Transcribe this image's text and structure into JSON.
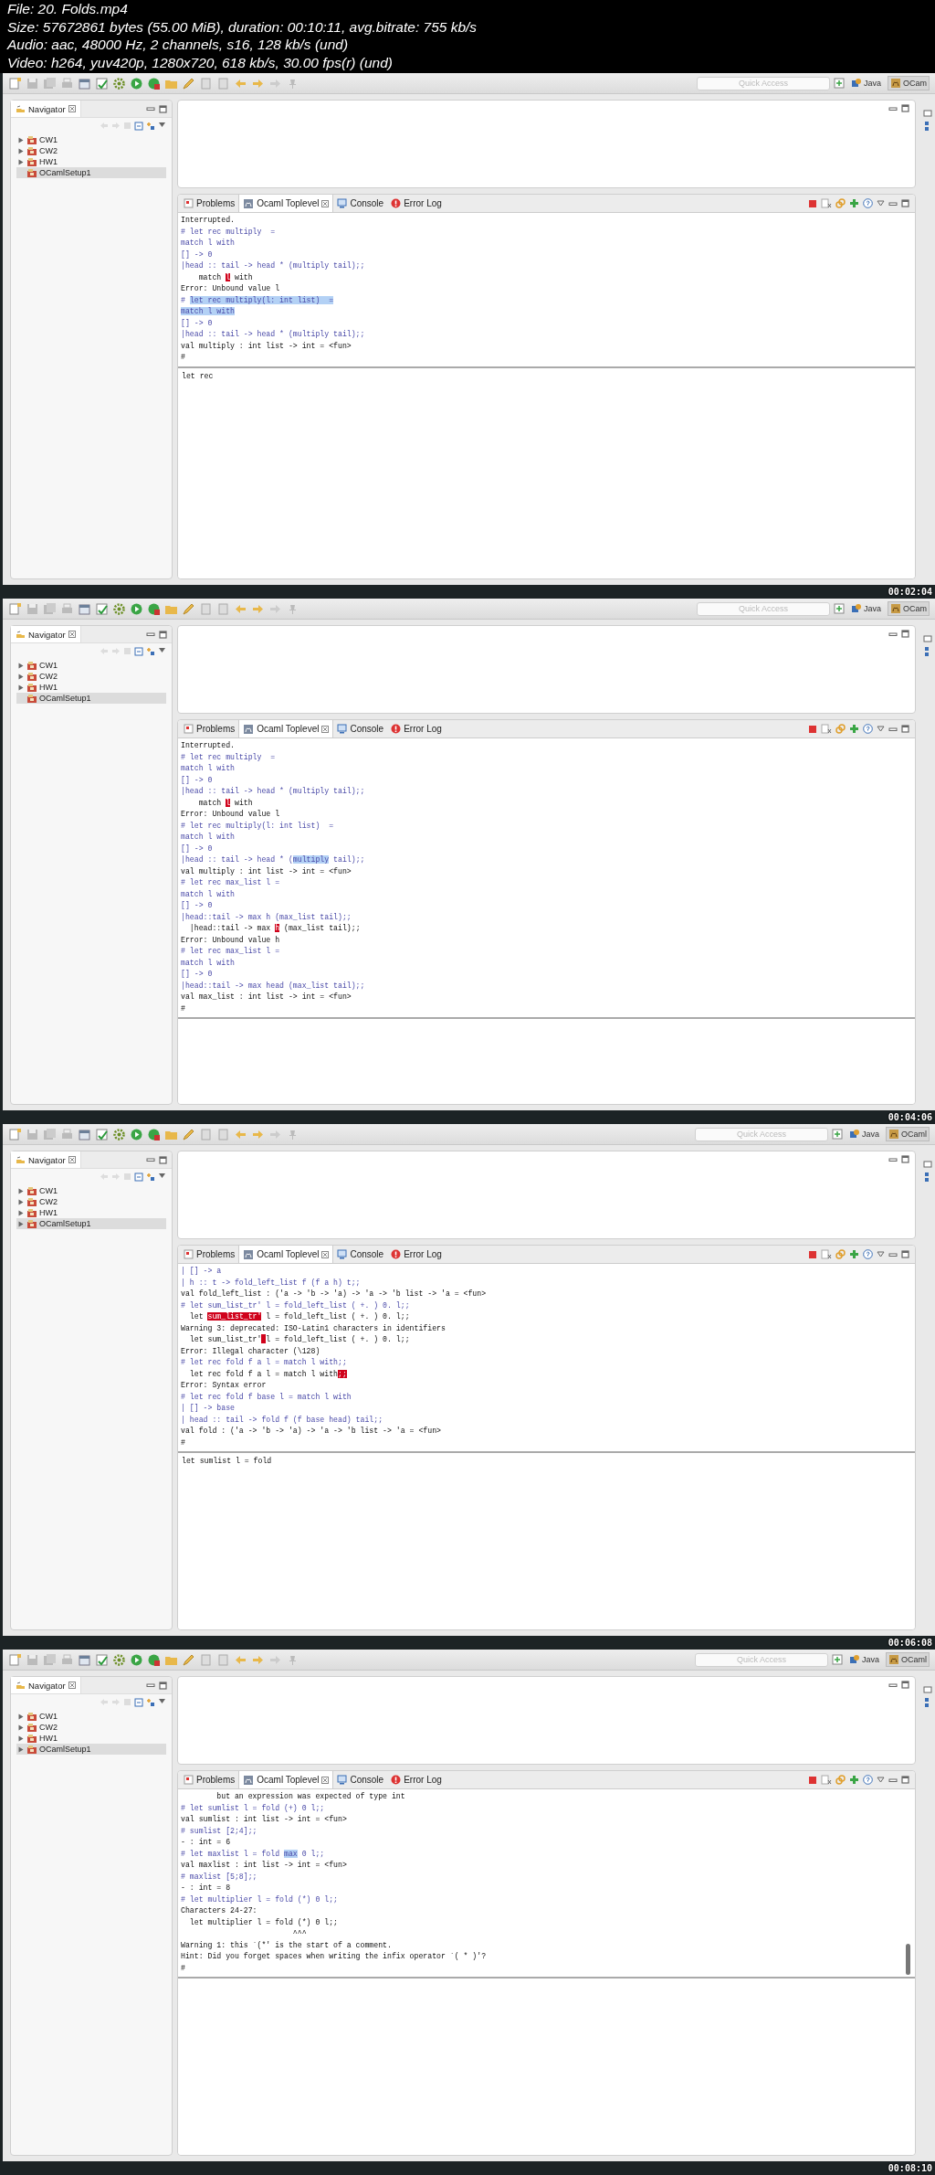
{
  "video_info": [
    "File: 20. Folds.mp4",
    "Size: 57672861 bytes (55.00 MiB), duration: 00:10:11, avg.bitrate: 755 kb/s",
    "Audio: aac, 48000 Hz, 2 channels, s16, 128 kb/s (und)",
    "Video: h264, yuv420p, 1280x720, 618 kb/s, 30.00 fps(r) (und)"
  ],
  "frames": [
    {
      "timestamp": "00:02:04",
      "quick_access": {
        "placeholder": "Quick Access"
      },
      "perspectives": [
        {
          "label": "Java",
          "selected": false
        },
        {
          "label": "OCam",
          "selected": true
        }
      ],
      "navigator": {
        "title": "Navigator",
        "items": [
          {
            "label": "CW1",
            "expandable": true,
            "selected": false
          },
          {
            "label": "CW2",
            "expandable": true,
            "selected": false
          },
          {
            "label": "HW1",
            "expandable": true,
            "selected": false
          },
          {
            "label": "OCamlSetup1",
            "expandable": false,
            "selected": true
          }
        ]
      },
      "console_tabs": [
        {
          "label": "Problems",
          "selected": false
        },
        {
          "label": "Ocaml Toplevel",
          "selected": true
        },
        {
          "label": "Console",
          "selected": false
        },
        {
          "label": "Error Log",
          "selected": false
        }
      ],
      "output": [
        {
          "kind": "output",
          "text": "Interrupted."
        },
        {
          "kind": "input",
          "text": "# let rec multiply  ="
        },
        {
          "kind": "input",
          "text": "match l with"
        },
        {
          "kind": "input",
          "text": "[] -> 0"
        },
        {
          "kind": "input",
          "text": "|head :: tail -> head * (multiply tail);;"
        },
        {
          "kind": "output",
          "parts": [
            {
              "kind": "plain",
              "text": "    match "
            },
            {
              "kind": "error",
              "text": "l"
            },
            {
              "kind": "plain",
              "text": " with"
            }
          ]
        },
        {
          "kind": "output",
          "text": "Error: Unbound value l"
        },
        {
          "kind": "input",
          "parts": [
            {
              "kind": "plain",
              "text": "# "
            },
            {
              "kind": "selection",
              "text": "let rec multiply(l: int list)  ="
            }
          ]
        },
        {
          "kind": "input",
          "parts": [
            {
              "kind": "selection",
              "text": "match l with"
            }
          ]
        },
        {
          "kind": "input",
          "text": "[] -> 0"
        },
        {
          "kind": "input",
          "text": "|head :: tail -> head * (multiply tail);;"
        },
        {
          "kind": "output",
          "text": "val multiply : int list -> int = <fun>"
        },
        {
          "kind": "output",
          "text": "#"
        }
      ],
      "input": {
        "value": "let rec "
      },
      "scrollbar": false
    },
    {
      "timestamp": "00:04:06",
      "quick_access": {
        "placeholder": "Quick Access"
      },
      "perspectives": [
        {
          "label": "Java",
          "selected": false
        },
        {
          "label": "OCam",
          "selected": true
        }
      ],
      "navigator": {
        "title": "Navigator",
        "items": [
          {
            "label": "CW1",
            "expandable": true,
            "selected": false
          },
          {
            "label": "CW2",
            "expandable": true,
            "selected": false
          },
          {
            "label": "HW1",
            "expandable": true,
            "selected": false
          },
          {
            "label": "OCamlSetup1",
            "expandable": false,
            "selected": true
          }
        ]
      },
      "console_tabs": [
        {
          "label": "Problems",
          "selected": false
        },
        {
          "label": "Ocaml Toplevel",
          "selected": true
        },
        {
          "label": "Console",
          "selected": false
        },
        {
          "label": "Error Log",
          "selected": false
        }
      ],
      "output": [
        {
          "kind": "output",
          "text": "Interrupted."
        },
        {
          "kind": "input",
          "text": "# let rec multiply  ="
        },
        {
          "kind": "input",
          "text": "match l with"
        },
        {
          "kind": "input",
          "text": "[] -> 0"
        },
        {
          "kind": "input",
          "text": "|head :: tail -> head * (multiply tail);;"
        },
        {
          "kind": "output",
          "parts": [
            {
              "kind": "plain",
              "text": "    match "
            },
            {
              "kind": "error",
              "text": "l"
            },
            {
              "kind": "plain",
              "text": " with"
            }
          ]
        },
        {
          "kind": "output",
          "text": "Error: Unbound value l"
        },
        {
          "kind": "input",
          "text": "# let rec multiply(l: int list)  ="
        },
        {
          "kind": "input",
          "text": "match l with"
        },
        {
          "kind": "input",
          "text": "[] -> 0"
        },
        {
          "kind": "input",
          "parts": [
            {
              "kind": "plain",
              "text": "|head :: tail -> head * ("
            },
            {
              "kind": "selection",
              "text": "multiply"
            },
            {
              "kind": "plain",
              "text": " tail);;"
            }
          ]
        },
        {
          "kind": "output",
          "text": "val multiply : int list -> int = <fun>"
        },
        {
          "kind": "input",
          "text": "# let rec max_list l ="
        },
        {
          "kind": "input",
          "text": "match l with"
        },
        {
          "kind": "input",
          "text": "[] -> 0"
        },
        {
          "kind": "input",
          "text": "|head::tail -> max h (max_list tail);;"
        },
        {
          "kind": "output",
          "parts": [
            {
              "kind": "plain",
              "text": "  |head::tail -> max "
            },
            {
              "kind": "error",
              "text": "h"
            },
            {
              "kind": "plain",
              "text": " (max_list tail);;"
            }
          ]
        },
        {
          "kind": "output",
          "text": "Error: Unbound value h"
        },
        {
          "kind": "input",
          "text": "# let rec max_list l ="
        },
        {
          "kind": "input",
          "text": "match l with"
        },
        {
          "kind": "input",
          "text": "[] -> 0"
        },
        {
          "kind": "input",
          "text": "|head::tail -> max head (max_list tail);;"
        },
        {
          "kind": "output",
          "text": "val max_list : int list -> int = <fun>"
        },
        {
          "kind": "output",
          "text": "#"
        }
      ],
      "scrollbar": false
    },
    {
      "timestamp": "00:06:08",
      "quick_access": {
        "placeholder": "Quick Access"
      },
      "perspectives": [
        {
          "label": "Java",
          "selected": false
        },
        {
          "label": "OCaml",
          "selected": true
        }
      ],
      "navigator": {
        "title": "Navigator",
        "items": [
          {
            "label": "CW1",
            "expandable": true,
            "selected": false
          },
          {
            "label": "CW2",
            "expandable": true,
            "selected": false
          },
          {
            "label": "HW1",
            "expandable": true,
            "selected": false
          },
          {
            "label": "OCamlSetup1",
            "expandable": true,
            "selected": true
          }
        ]
      },
      "console_tabs": [
        {
          "label": "Problems",
          "selected": false
        },
        {
          "label": "Ocaml Toplevel",
          "selected": true
        },
        {
          "label": "Console",
          "selected": false
        },
        {
          "label": "Error Log",
          "selected": false
        }
      ],
      "output": [
        {
          "kind": "input",
          "text": "| [] -> a"
        },
        {
          "kind": "input",
          "text": "| h :: t -> fold_left_list f (f a h) t;;"
        },
        {
          "kind": "output",
          "text": "val fold_left_list : ('a -> 'b -> 'a) -> 'a -> 'b list -> 'a = <fun>"
        },
        {
          "kind": "input",
          "text": "# let sum_list_tr' l = fold_left_list ( +. ) 0. l;;"
        },
        {
          "kind": "output",
          "parts": [
            {
              "kind": "plain",
              "text": "  let "
            },
            {
              "kind": "error",
              "text": "sum_list_tr'"
            },
            {
              "kind": "plain",
              "text": " l = fold_left_list ( +. ) 0. l;;"
            }
          ]
        },
        {
          "kind": "output",
          "text": "Warning 3: deprecated: ISO-Latin1 characters in identifiers"
        },
        {
          "kind": "output",
          "parts": [
            {
              "kind": "plain",
              "text": "  let sum_list_tr'"
            },
            {
              "kind": "error_block"
            },
            {
              "kind": "plain",
              "text": "l = fold_left_list ( +. ) 0. l;;"
            }
          ]
        },
        {
          "kind": "output",
          "text": "Error: Illegal character (\\128)"
        },
        {
          "kind": "input",
          "text": "# let rec fold f a l = match l with;;"
        },
        {
          "kind": "output",
          "parts": [
            {
              "kind": "plain",
              "text": "  let rec fold f a l = match l with"
            },
            {
              "kind": "error",
              "text": ";;"
            }
          ]
        },
        {
          "kind": "output",
          "text": "Error: Syntax error"
        },
        {
          "kind": "input",
          "text": "# let rec fold f base l = match l with"
        },
        {
          "kind": "input",
          "text": "| [] -> base"
        },
        {
          "kind": "input",
          "text": "| head :: tail -> fold f (f base head) tail;;"
        },
        {
          "kind": "output",
          "text": "val fold : ('a -> 'b -> 'a) -> 'a -> 'b list -> 'a = <fun>"
        },
        {
          "kind": "output",
          "text": "#"
        }
      ],
      "input": {
        "value": "let sumlist l = fold"
      },
      "scrollbar": false
    },
    {
      "timestamp": "00:08:10",
      "quick_access": {
        "placeholder": "Quick Access"
      },
      "perspectives": [
        {
          "label": "Java",
          "selected": false
        },
        {
          "label": "OCaml",
          "selected": true
        }
      ],
      "navigator": {
        "title": "Navigator",
        "items": [
          {
            "label": "CW1",
            "expandable": true,
            "selected": false
          },
          {
            "label": "CW2",
            "expandable": true,
            "selected": false
          },
          {
            "label": "HW1",
            "expandable": true,
            "selected": false
          },
          {
            "label": "OCamlSetup1",
            "expandable": true,
            "selected": true
          }
        ]
      },
      "console_tabs": [
        {
          "label": "Problems",
          "selected": false
        },
        {
          "label": "Ocaml Toplevel",
          "selected": true
        },
        {
          "label": "Console",
          "selected": false
        },
        {
          "label": "Error Log",
          "selected": false
        }
      ],
      "output": [
        {
          "kind": "output",
          "text": "        but an expression was expected of type int"
        },
        {
          "kind": "input",
          "text": "# let sumlist l = fold (+) 0 l;;"
        },
        {
          "kind": "output",
          "text": "val sumlist : int list -> int = <fun>"
        },
        {
          "kind": "input",
          "text": "# sumlist [2;4];;"
        },
        {
          "kind": "output",
          "text": "- : int = 6"
        },
        {
          "kind": "input",
          "parts": [
            {
              "kind": "plain",
              "text": "# let maxlist l = fold "
            },
            {
              "kind": "selection",
              "text": "max"
            },
            {
              "kind": "plain",
              "text": " 0 l;;"
            }
          ]
        },
        {
          "kind": "output",
          "text": "val maxlist : int list -> int = <fun>"
        },
        {
          "kind": "input",
          "text": "# maxlist [5;8];;"
        },
        {
          "kind": "output",
          "text": "- : int = 8"
        },
        {
          "kind": "input",
          "text": "# let multiplier l = fold (*) 0 l;;"
        },
        {
          "kind": "output",
          "text": "Characters 24-27:"
        },
        {
          "kind": "output",
          "text": "  let multiplier l = fold (*) 0 l;;"
        },
        {
          "kind": "output",
          "text": "                         ^^^"
        },
        {
          "kind": "output",
          "text": "Warning 1: this `(*' is the start of a comment."
        },
        {
          "kind": "output",
          "text": "Hint: Did you forget spaces when writing the infix operator `( * )'?"
        },
        {
          "kind": "output",
          "text": "#"
        }
      ],
      "scrollbar": true
    }
  ]
}
